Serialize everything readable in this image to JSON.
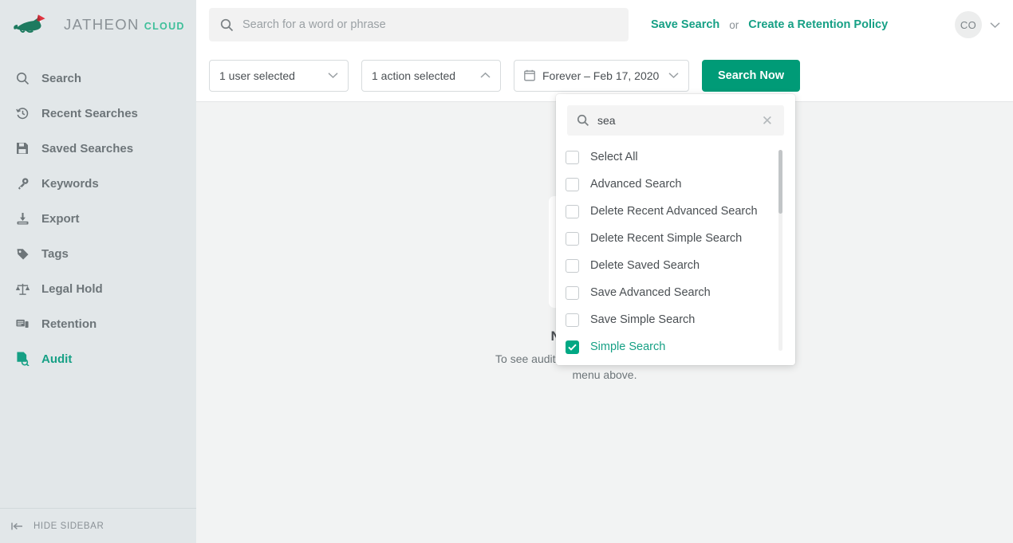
{
  "brand": {
    "logo_name": "jatheon-fox-logo",
    "title_primary": "JATHEON",
    "title_secondary": "CLOUD",
    "accent_teal": "#16a085",
    "accent_green": "#009b77",
    "logo_red": "#e0333f",
    "sidebar_bg": "#e2e7e9",
    "content_bg": "#f2f3f3"
  },
  "sidebar": {
    "items": [
      {
        "label": "Search",
        "icon": "magnifier-icon",
        "active": false
      },
      {
        "label": "Recent Searches",
        "icon": "history-clock-icon",
        "active": false
      },
      {
        "label": "Saved Searches",
        "icon": "floppy-save-icon",
        "active": false
      },
      {
        "label": "Keywords",
        "icon": "key-icon",
        "active": false
      },
      {
        "label": "Export",
        "icon": "download-export-icon",
        "active": false
      },
      {
        "label": "Tags",
        "icon": "tag-icon",
        "active": false
      },
      {
        "label": "Legal Hold",
        "icon": "scales-balance-icon",
        "active": false
      },
      {
        "label": "Retention",
        "icon": "retention-stack-icon",
        "active": false
      },
      {
        "label": "Audit",
        "icon": "audit-document-magnifier-icon",
        "active": true
      }
    ],
    "footer": {
      "label": "HIDE SIDEBAR",
      "icon": "collapse-left-icon"
    }
  },
  "topbar": {
    "search": {
      "placeholder": "Search for a word or phrase",
      "value": "",
      "icon": "search-icon"
    },
    "save_search_label": "Save Search",
    "or_label": "or",
    "create_policy_label": "Create a Retention Policy",
    "avatar": {
      "initials": "CO",
      "caret_icon": "chevron-down-icon"
    }
  },
  "filterbar": {
    "user_filter": {
      "label": "1 user selected",
      "caret_icon": "chevron-down-icon",
      "expanded": false
    },
    "action_filter": {
      "label": "1 action selected",
      "caret_icon": "chevron-up-icon",
      "expanded": true
    },
    "date_filter": {
      "label": "Forever – Feb 17, 2020",
      "calendar_icon": "calendar-icon",
      "caret_icon": "chevron-down-icon"
    },
    "search_now_label": "Search Now"
  },
  "action_dropdown": {
    "search": {
      "value": "sea",
      "placeholder": "",
      "icon": "search-icon",
      "clear_icon": "close-x-icon"
    },
    "options": [
      {
        "label": "Select All",
        "checked": false
      },
      {
        "label": "Advanced Search",
        "checked": false
      },
      {
        "label": "Delete Recent Advanced Search",
        "checked": false
      },
      {
        "label": "Delete Recent Simple Search",
        "checked": false
      },
      {
        "label": "Delete Saved Search",
        "checked": false
      },
      {
        "label": "Save Advanced Search",
        "checked": false
      },
      {
        "label": "Save Simple Search",
        "checked": false
      },
      {
        "label": "Simple Search",
        "checked": true
      }
    ]
  },
  "empty_state": {
    "illustration": "documents-with-magnifier-illustration",
    "title": "Nothing to Show",
    "subtitle": "To see audit logs, choose the filters from the menu above."
  }
}
